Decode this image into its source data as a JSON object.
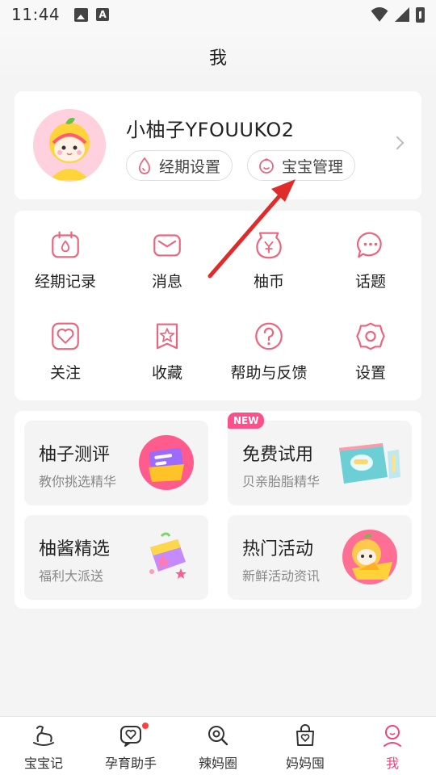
{
  "status_bar": {
    "time": "11:44"
  },
  "header": {
    "title": "我"
  },
  "profile": {
    "username": "小柚子YFOUUKO2",
    "period_settings_label": "经期设置",
    "baby_management_label": "宝宝管理"
  },
  "features": [
    {
      "label": "经期记录",
      "icon": "calendar-drop-icon"
    },
    {
      "label": "消息",
      "icon": "envelope-icon"
    },
    {
      "label": "柚币",
      "icon": "coin-bag-icon"
    },
    {
      "label": "话题",
      "icon": "chat-bubble-icon"
    },
    {
      "label": "关注",
      "icon": "heart-box-icon"
    },
    {
      "label": "收藏",
      "icon": "star-bookmark-icon"
    },
    {
      "label": "帮助与反馈",
      "icon": "help-icon"
    },
    {
      "label": "设置",
      "icon": "gear-icon"
    }
  ],
  "promos": [
    {
      "title": "柚子测评",
      "subtitle": "教你挑选精华",
      "icon": "review-folder-icon"
    },
    {
      "title": "免费试用",
      "subtitle": "贝亲胎脂精华",
      "badge": "NEW",
      "icon": "product-box-icon"
    },
    {
      "title": "柚酱精选",
      "subtitle": "福利大派送",
      "icon": "gift-star-icon"
    },
    {
      "title": "热门活动",
      "subtitle": "新鲜活动资讯",
      "icon": "mascot-icon"
    }
  ],
  "bottom_nav": [
    {
      "label": "宝宝记",
      "icon": "rocking-horse-icon"
    },
    {
      "label": "孕育助手",
      "icon": "heart-chat-icon"
    },
    {
      "label": "辣妈圈",
      "icon": "search-circle-icon"
    },
    {
      "label": "妈妈囤",
      "icon": "shopping-bag-icon"
    },
    {
      "label": "我",
      "icon": "person-icon",
      "active": true
    }
  ],
  "colors": {
    "accent": "#f0447a",
    "icon_pink": "#e8677f",
    "badge": "#ff4f8b"
  }
}
